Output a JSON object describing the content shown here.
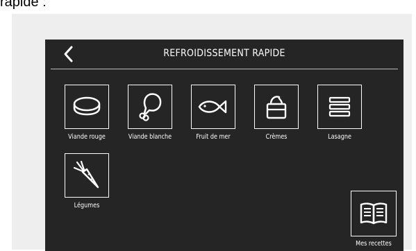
{
  "caption": "rapide :",
  "header": {
    "title": "REFROIDISSEMENT RAPIDE",
    "back_icon": "chevron-left-icon"
  },
  "categories": [
    {
      "label": "Viande rouge",
      "icon": "steak-icon"
    },
    {
      "label": "Viande blanche",
      "icon": "chicken-leg-icon"
    },
    {
      "label": "Fruit de mer",
      "icon": "fish-icon"
    },
    {
      "label": "Crèmes",
      "icon": "cream-jar-icon"
    },
    {
      "label": "Lasagne",
      "icon": "lasagna-icon"
    },
    {
      "label": "Légumes",
      "icon": "carrot-icon"
    }
  ],
  "recipes": {
    "label": "Mes recettes",
    "icon": "book-icon"
  },
  "colors": {
    "screen_bg": "#252525",
    "frame_bg": "#eeeeee",
    "foreground": "#ffffff"
  }
}
